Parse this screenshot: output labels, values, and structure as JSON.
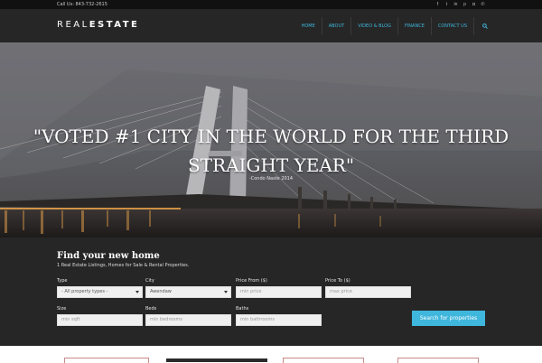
{
  "topbar": {
    "phone": "Call Us: 843-732-2615",
    "socials": [
      {
        "icon": "facebook-icon",
        "glyph": "f"
      },
      {
        "icon": "twitter-icon",
        "glyph": "t"
      },
      {
        "icon": "linkedin-icon",
        "glyph": "in"
      },
      {
        "icon": "pinterest-icon",
        "glyph": "p"
      },
      {
        "icon": "instagram-icon",
        "glyph": "◘"
      },
      {
        "icon": "phone-icon",
        "glyph": "✆"
      }
    ]
  },
  "header": {
    "logo_part1": "REAL",
    "logo_part2": "ESTATE",
    "nav": [
      "HOME",
      "ABOUT",
      "VIDEO & BLOG",
      "FINANCE",
      "CONTACT US"
    ],
    "search_icon": "search-icon"
  },
  "hero": {
    "quote_line1": "\"VOTED #1 CITY IN THE WORLD FOR THE THIRD",
    "quote_line2": "STRAIGHT YEAR\"",
    "source": "-Condo Naste 2014"
  },
  "search": {
    "title": "Find your new home",
    "subtitle": "1 Real Estate Listings, Homes for Sale & Rental Properties.",
    "fields": {
      "type": {
        "label": "Type",
        "value": "- All property types -"
      },
      "city": {
        "label": "City",
        "value": "Awendaw"
      },
      "price_from": {
        "label": "Price From ($)",
        "placeholder": "min price"
      },
      "price_to": {
        "label": "Price To ($)",
        "placeholder": "max price"
      },
      "size": {
        "label": "Size",
        "placeholder": "min sqft"
      },
      "beds": {
        "label": "Beds",
        "placeholder": "min bedrooms"
      },
      "baths": {
        "label": "Baths",
        "placeholder": "min bathrooms"
      }
    },
    "button": "Search for properties"
  },
  "colors": {
    "accent": "#3fb6dc",
    "header_bg": "#262626",
    "topbar_bg": "#111111"
  }
}
